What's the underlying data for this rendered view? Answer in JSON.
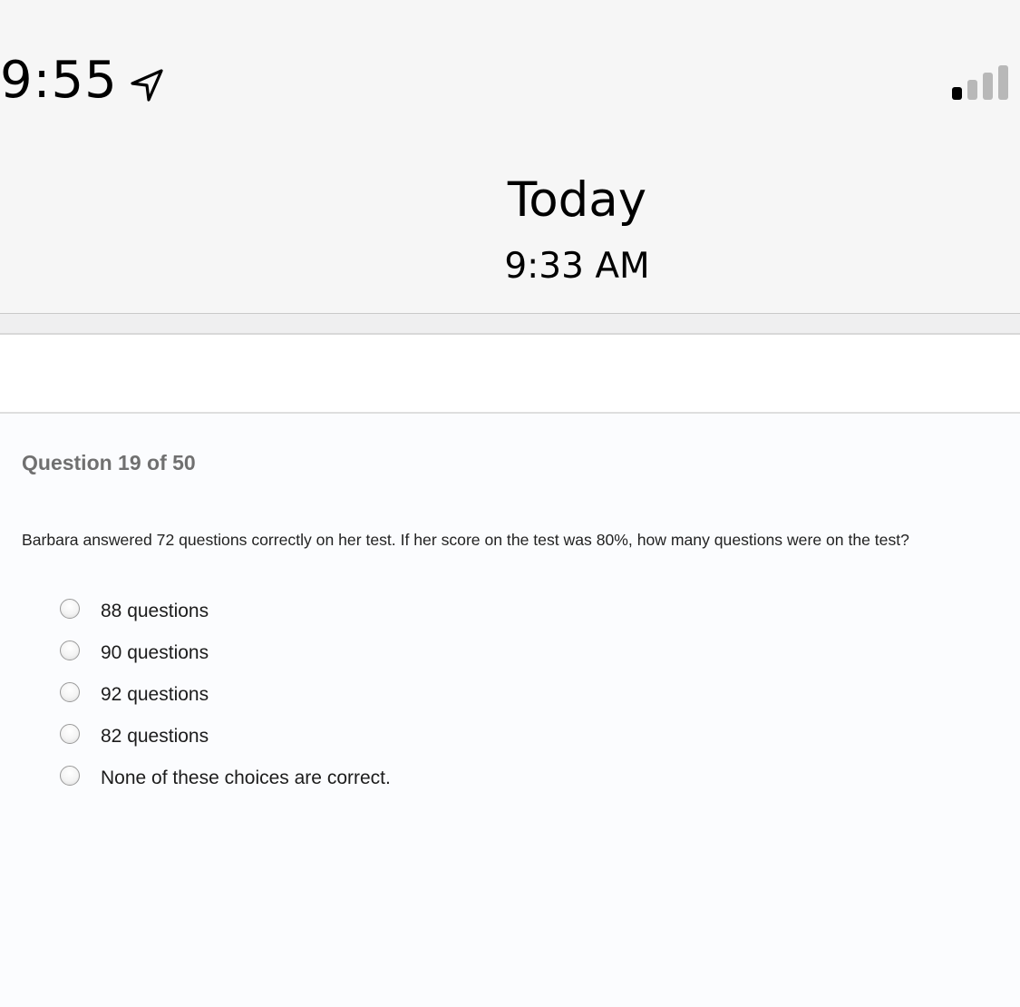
{
  "status_bar": {
    "time": "9:55",
    "location_icon": "location-arrow-icon",
    "signal_icon": "cellular-signal-icon"
  },
  "header": {
    "title": "Today",
    "time": "9:33 AM"
  },
  "quiz": {
    "question_number": "Question 19 of 50",
    "question_text": "Barbara answered 72 questions correctly on her test. If her score on the test was 80%, how many questions were on the test?",
    "options": [
      "88 questions",
      "90 questions",
      "92 questions",
      "82 questions",
      "None of these choices are correct."
    ]
  }
}
